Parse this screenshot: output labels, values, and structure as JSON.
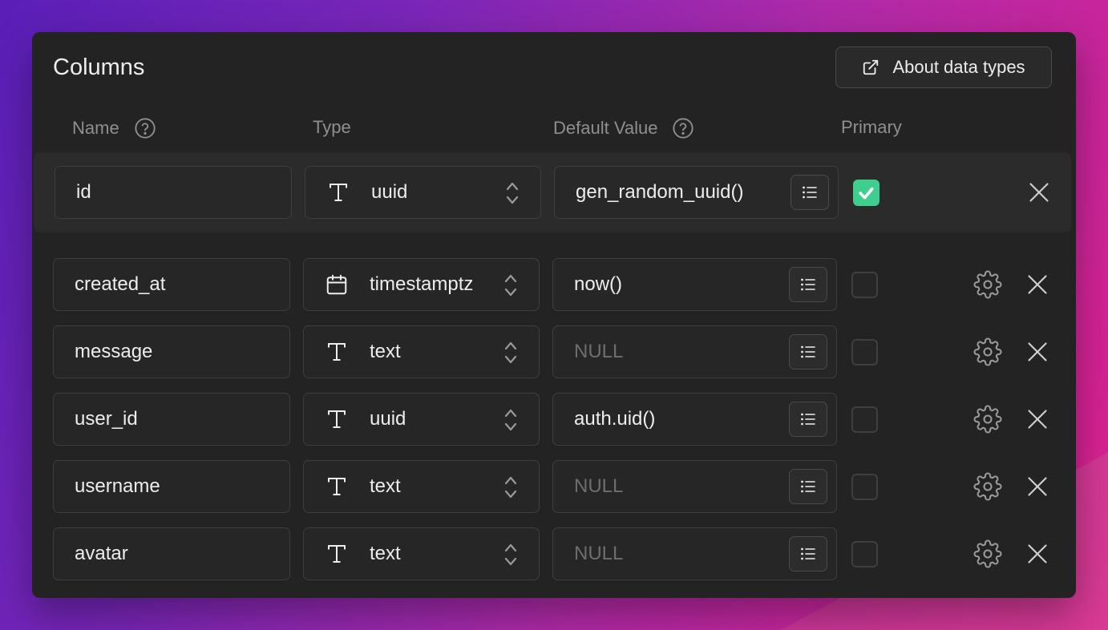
{
  "panel": {
    "title": "Columns",
    "about_button": "About data types"
  },
  "headers": {
    "name": "Name",
    "type": "Type",
    "default_value": "Default Value",
    "primary": "Primary"
  },
  "columns": [
    {
      "name": "id",
      "type": "uuid",
      "type_icon": "text-type-icon",
      "default": "gen_random_uuid()",
      "default_is_placeholder": false,
      "primary": true,
      "has_settings": false
    },
    {
      "name": "created_at",
      "type": "timestamptz",
      "type_icon": "calendar-icon",
      "default": "now()",
      "default_is_placeholder": false,
      "primary": false,
      "has_settings": true
    },
    {
      "name": "message",
      "type": "text",
      "type_icon": "text-type-icon",
      "default": "NULL",
      "default_is_placeholder": true,
      "primary": false,
      "has_settings": true
    },
    {
      "name": "user_id",
      "type": "uuid",
      "type_icon": "text-type-icon",
      "default": "auth.uid()",
      "default_is_placeholder": false,
      "primary": false,
      "has_settings": true
    },
    {
      "name": "username",
      "type": "text",
      "type_icon": "text-type-icon",
      "default": "NULL",
      "default_is_placeholder": true,
      "primary": false,
      "has_settings": true
    },
    {
      "name": "avatar",
      "type": "text",
      "type_icon": "text-type-icon",
      "default": "NULL",
      "default_is_placeholder": true,
      "primary": false,
      "has_settings": true
    }
  ],
  "colors": {
    "panel_bg": "#232323",
    "accent_green": "#3ecf8e",
    "muted_text": "#8f8f8f",
    "placeholder_text": "#6e6e6e"
  }
}
